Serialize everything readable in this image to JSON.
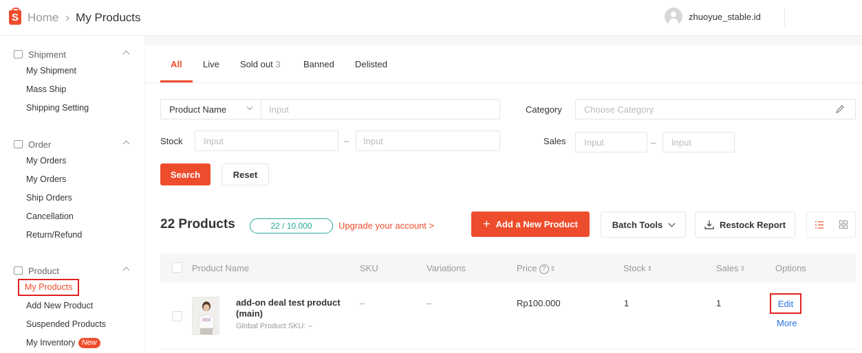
{
  "header": {
    "logo_letter": "S",
    "breadcrumb_home": "Home",
    "breadcrumb_sep": "›",
    "breadcrumb_current": "My Products",
    "username": "zhuoyue_stable.id"
  },
  "sidebar": {
    "groups": [
      {
        "title": "Shipment",
        "items": [
          "My Shipment",
          "Mass Ship",
          "Shipping Setting"
        ]
      },
      {
        "title": "Order",
        "items": [
          "My Orders",
          "My Orders",
          "Ship Orders",
          "Cancellation",
          "Return/Refund"
        ]
      },
      {
        "title": "Product",
        "items": [
          "My Products",
          "Add New Product",
          "Suspended Products",
          "My Inventory"
        ],
        "active_item": "My Products",
        "new_badge": "New"
      }
    ]
  },
  "tabs": [
    {
      "label": "All",
      "active": true
    },
    {
      "label": "Live"
    },
    {
      "label": "Sold out",
      "count": "3"
    },
    {
      "label": "Banned"
    },
    {
      "label": "Delisted"
    }
  ],
  "filters": {
    "name_select": "Product Name",
    "name_placeholder": "Input",
    "category_label": "Category",
    "category_placeholder": "Choose Category",
    "stock_label": "Stock",
    "stock_min_placeholder": "Input",
    "stock_max_placeholder": "Input",
    "sales_label": "Sales",
    "sales_min_placeholder": "Input",
    "sales_max_placeholder": "Input",
    "range_dash": "–",
    "search_button": "Search",
    "reset_button": "Reset"
  },
  "summary": {
    "products_count": "22 Products",
    "quota": "22 / 10.000",
    "upgrade_link": "Upgrade your account >",
    "add_button": "Add a New Product",
    "batch_tools": "Batch Tools",
    "restock_report": "Restock Report"
  },
  "table": {
    "headers": {
      "name": "Product Name",
      "sku": "SKU",
      "variations": "Variations",
      "price": "Price",
      "stock": "Stock",
      "sales": "Sales",
      "options": "Options"
    },
    "rows": [
      {
        "name": "add-on deal test product(main)",
        "global_sku": "Global Product SKU: –",
        "sku": "–",
        "variations": "–",
        "price": "Rp100.000",
        "stock": "1",
        "sales": "1",
        "edit": "Edit",
        "more": "More"
      }
    ]
  },
  "colors": {
    "brand": "#ee4d2d",
    "link": "#2673dd",
    "teal": "#26aa99",
    "highlight": "#e02020"
  }
}
